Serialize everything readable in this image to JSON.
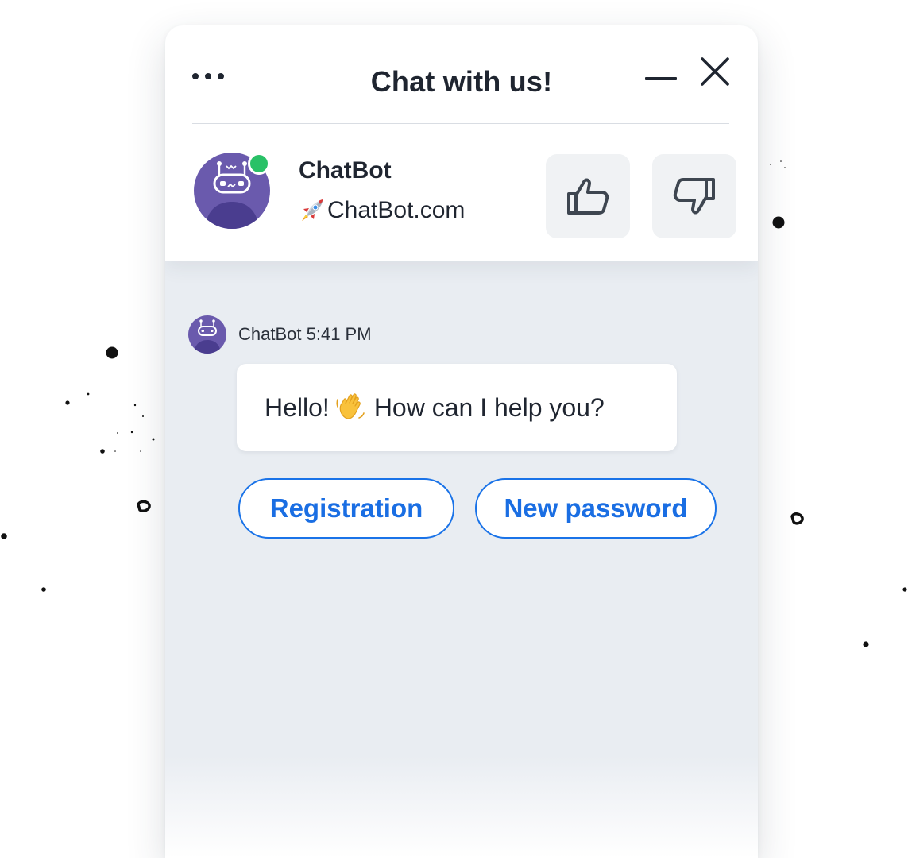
{
  "window": {
    "title": "Chat with us!",
    "menu_icon": "more-dots-icon",
    "minimize_icon": "minimize-icon",
    "close_icon": "close-icon"
  },
  "agent": {
    "name": "ChatBot",
    "site": "ChatBot.com",
    "site_icon": "rocket-icon",
    "avatar_icon": "robot-avatar-icon",
    "status": "online",
    "status_color": "#29c167"
  },
  "rating": {
    "up_icon": "thumbs-up-icon",
    "down_icon": "thumbs-down-icon"
  },
  "conversation": {
    "messages": [
      {
        "sender": "ChatBot",
        "time": "5:41 PM",
        "text_before": "Hello!",
        "emoji": "waving-hand-icon",
        "text_after": "How can I help you?"
      }
    ],
    "quick_replies": [
      "Registration",
      "New password"
    ]
  },
  "colors": {
    "accent": "#1a73e8",
    "avatar": "#6a5aad",
    "chat_background": "#e9edf2"
  }
}
